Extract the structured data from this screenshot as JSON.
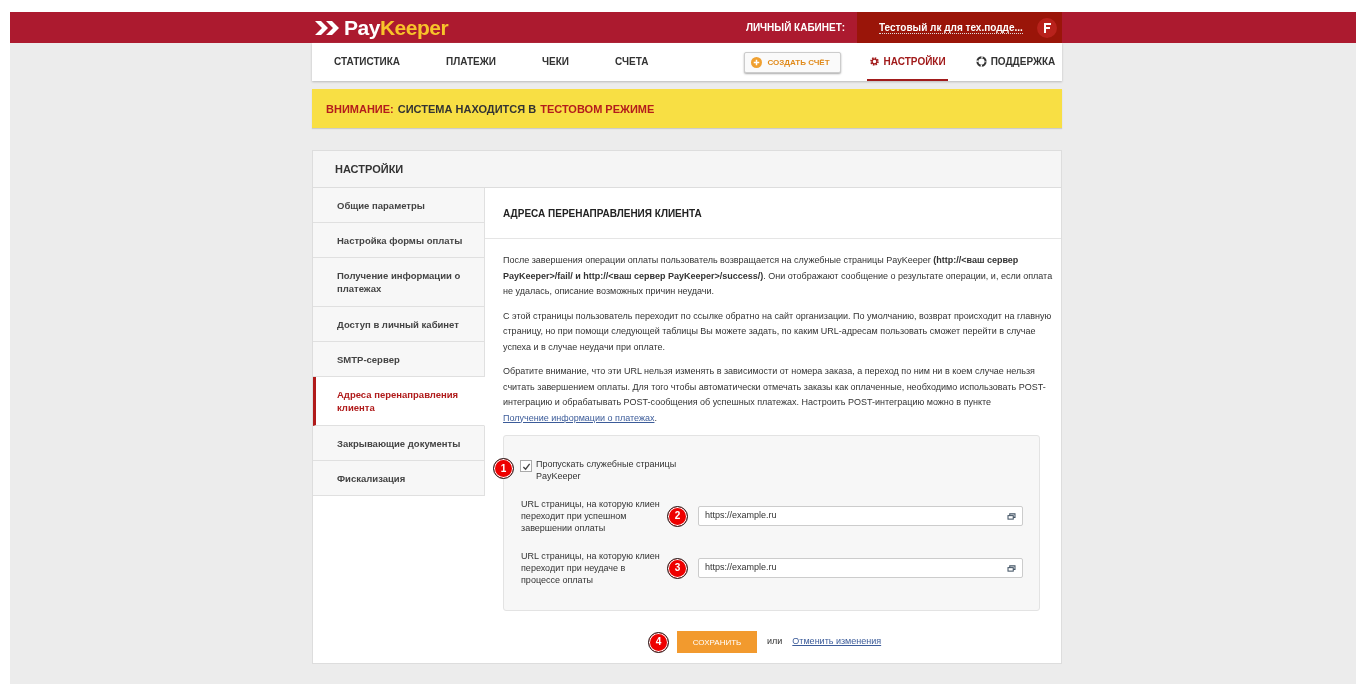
{
  "header": {
    "logo": {
      "first": "Pay",
      "second": "Keeper"
    },
    "cabinet_label": "ЛИЧНЫЙ КАБИНЕТ:",
    "account": "Тестовый лк для тех.подде..."
  },
  "nav": {
    "items": [
      {
        "label": "СТАТИСТИКА",
        "selected": false
      },
      {
        "label": "ПЛАТЕЖИ",
        "selected": false
      },
      {
        "label": "ЧЕКИ",
        "selected": false
      },
      {
        "label": "СЧЕТА",
        "selected": false
      }
    ],
    "create_button": "СОЗДАТЬ СЧЁТ",
    "right_items": [
      {
        "label": "НАСТРОЙКИ",
        "selected": true,
        "kind": "settings"
      },
      {
        "label": "ПОДДЕРЖКА",
        "selected": false,
        "kind": "support"
      }
    ]
  },
  "banner": {
    "attention": "ВНИМАНИЕ:",
    "text": "СИСТЕМА НАХОДИТСЯ В",
    "mode": "ТЕСТОВОМ РЕЖИМЕ"
  },
  "settings": {
    "title": "НАСТРОЙКИ",
    "sidebar": {
      "items": [
        {
          "label": "Общие параметры",
          "selected": false
        },
        {
          "label": "Настройка формы оплаты",
          "selected": false
        },
        {
          "label": "Получение информации о платежах",
          "selected": false
        },
        {
          "label": "Доступ в личный кабинет",
          "selected": false
        },
        {
          "label": "SMTP-сервер",
          "selected": false
        },
        {
          "label": "Адреса перенаправления клиента",
          "selected": true
        },
        {
          "label": "Закрывающие документы",
          "selected": false
        },
        {
          "label": "Фискализация",
          "selected": false
        }
      ]
    },
    "content": {
      "title": "АДРЕСА ПЕРЕНАПРАВЛЕНИЯ КЛИЕНТА",
      "paragraphs": [
        "После завершения операции оплаты пользователь возвращается на служебные страницы PayKeeper **(http://<ваш сервер PayKeeper>/fail/ и http://<ваш сервер PayKeeper>/success/)**. Они отображают сообщение о результате операции, и, если оплата не удалась, описание возможных причин неудачи.",
        "С этой страницы пользователь переходит по ссылке обратно на сайт организации. По умолчанию, возврат происходит на главную страницу, но при помощи следующей таблицы Вы можете задать, по каким URL-адресам пользовать сможет перейти в случае успеха и в случае неудачи при оплате."
      ],
      "note": {
        "text": "Обратите внимание, что эти URL нельзя изменять в зависимости от номера заказа, а переход по ним ни в коем случае нельзя считать завершением оплаты. Для того чтобы автоматически отмечать заказы как оплаченные, необходимо использовать POST-интеграцию и обрабатывать POST-сообщения об успешных платежах. Настроить POST-интеграцию можно в пункте",
        "link": "Получение информации о платежах",
        "after": "."
      },
      "form": {
        "skip": {
          "marker": "1",
          "label": "Пропускать служебные страницы PayKeeper",
          "checked": true
        },
        "fields": [
          {
            "marker": "2",
            "label": "URL страницы, на которую клиен переходит при успешном завершении оплаты",
            "value": "https://example.ru"
          },
          {
            "marker": "3",
            "label": "URL страницы, на которую клиен переходит при неудаче в процессе оплаты",
            "value": "https://example.ru"
          }
        ]
      },
      "actions": {
        "marker": "4",
        "save": "СОХРАНИТЬ",
        "or": "или",
        "cancel": "Отменить изменения"
      }
    }
  }
}
